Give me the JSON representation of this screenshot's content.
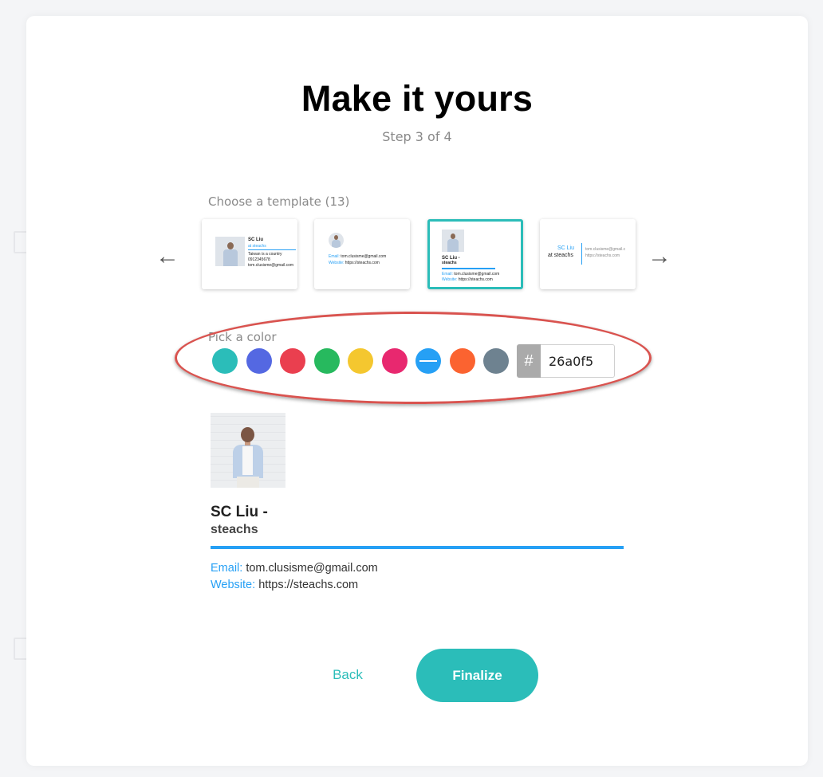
{
  "header": {
    "title": "Make it yours",
    "step": "Step 3 of 4"
  },
  "templates": {
    "label": "Choose a template (13)",
    "prev_arrow": "←",
    "next_arrow": "→",
    "items": [
      {
        "name": "SC Liu",
        "company": "at steachs",
        "lines": [
          "Taiwan is a country",
          "0912345678",
          "tom.clusisme@gmail.com"
        ]
      },
      {
        "email_key": "Email:",
        "email": "tom.clusisme@gmail.com",
        "website_key": "Website:",
        "website": "https://steachs.com"
      },
      {
        "name": "SC Liu -",
        "company": "steachs",
        "email_key": "Email:",
        "email": "tom.clusisme@gmail.com",
        "website_key": "Website:",
        "website": "https://steachs.com"
      },
      {
        "name": "SC Liu",
        "company": "at steachs",
        "email": "tom.clusisme@gmail.c",
        "website": "https://steachs.com"
      }
    ]
  },
  "color_picker": {
    "label": "Pick a color",
    "swatches": [
      "#2bbdb9",
      "#5468e2",
      "#ea3f4f",
      "#27b95e",
      "#f4c72f",
      "#e8286f",
      "#26a0f5",
      "#fb6330",
      "#6e8290"
    ],
    "hash_symbol": "#",
    "hex_value": "26a0f5"
  },
  "signature": {
    "name": "SC Liu -",
    "company": "steachs",
    "email_key": "Email:",
    "email": "tom.clusisme@gmail.com",
    "website_key": "Website:",
    "website": "https://steachs.com"
  },
  "actions": {
    "back": "Back",
    "finalize": "Finalize"
  }
}
